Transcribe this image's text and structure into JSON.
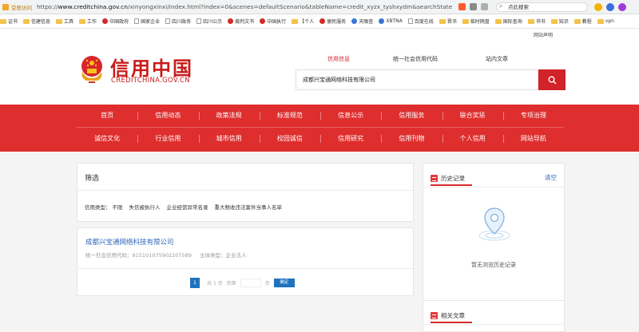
{
  "browser": {
    "secure_label": "受限访问",
    "url_prefix": "https://",
    "url_host": "www.creditchina.gov.cn",
    "url_path": "/xinyongxinxi/index.html?index=0&scenes=defaultScenario&tableName=credit_xyzx_tyshxydm&searchState=2&entityT",
    "search_placeholder": "点此搜索"
  },
  "bookmarks": [
    {
      "label": "证书",
      "icon": "folder-icon"
    },
    {
      "label": "信建信息",
      "icon": "folder-icon"
    },
    {
      "label": "工具",
      "icon": "folder-icon"
    },
    {
      "label": "工作",
      "icon": "folder-icon"
    },
    {
      "label": "中国政府",
      "icon": "emblem-icon"
    },
    {
      "label": "国家企业",
      "icon": "page-icon"
    },
    {
      "label": "四川政务",
      "icon": "page-icon"
    },
    {
      "label": "四川公示",
      "icon": "page-icon"
    },
    {
      "label": "裁判文书",
      "icon": "emblem-icon"
    },
    {
      "label": "中国执行",
      "icon": "emblem-icon"
    },
    {
      "label": "【个人",
      "icon": "folder-icon"
    },
    {
      "label": "便民服务",
      "icon": "emblem-icon"
    },
    {
      "label": "天眼查",
      "icon": "globe-icon"
    },
    {
      "label": "XBTNA",
      "icon": "globe-icon"
    },
    {
      "label": "百度在线",
      "icon": "page-icon"
    },
    {
      "label": "晋书",
      "icon": "folder-icon"
    },
    {
      "label": "临时网盘",
      "icon": "folder-icon"
    },
    {
      "label": "国际查询",
      "icon": "folder-icon"
    },
    {
      "label": "书书",
      "icon": "folder-icon"
    },
    {
      "label": "知识",
      "icon": "folder-icon"
    },
    {
      "label": "教程",
      "icon": "folder-icon"
    },
    {
      "label": "vpn",
      "icon": "folder-icon"
    }
  ],
  "site": {
    "help_link": "网站声明",
    "logo_cn": "信用中国",
    "logo_en": "CREDITCHINA.GOV.CN",
    "search_tabs": [
      "信用信息",
      "统一社会信用代码",
      "站内文章"
    ],
    "search_value": "成都兴宝通网络科技有限公司",
    "nav_row1": [
      "首页",
      "信用动态",
      "政策法规",
      "标准规范",
      "信息公示",
      "信用服务",
      "联合奖惩",
      "专项治理"
    ],
    "nav_row2": [
      "诚信文化",
      "行业信用",
      "城市信用",
      "校园诚信",
      "信用研究",
      "信用刊物",
      "个人信用",
      "网站导航"
    ]
  },
  "filter": {
    "title": "筛选",
    "type_label": "信用类型：",
    "options": [
      "不限",
      "失信被执行人",
      "企业经营异常名录",
      "重大税收违法案件当事人名单"
    ]
  },
  "result": {
    "company_name": "成都兴宝通网络科技有限公司",
    "code_label": "统一社会信用代码：",
    "code_value": "91510107590220758​9",
    "subject_label": "主体类型：",
    "subject_value": "企业法人"
  },
  "pager": {
    "current_page": "1",
    "total_prefix": "共",
    "total_pages": "1",
    "total_suffix": "页",
    "goto_label": "到第",
    "page_suffix": "页",
    "confirm_label": "确定"
  },
  "history": {
    "title": "历史记录",
    "clear_label": "清空",
    "empty_text": "暂无浏览历史记录"
  },
  "related": {
    "title": "相关文章"
  }
}
